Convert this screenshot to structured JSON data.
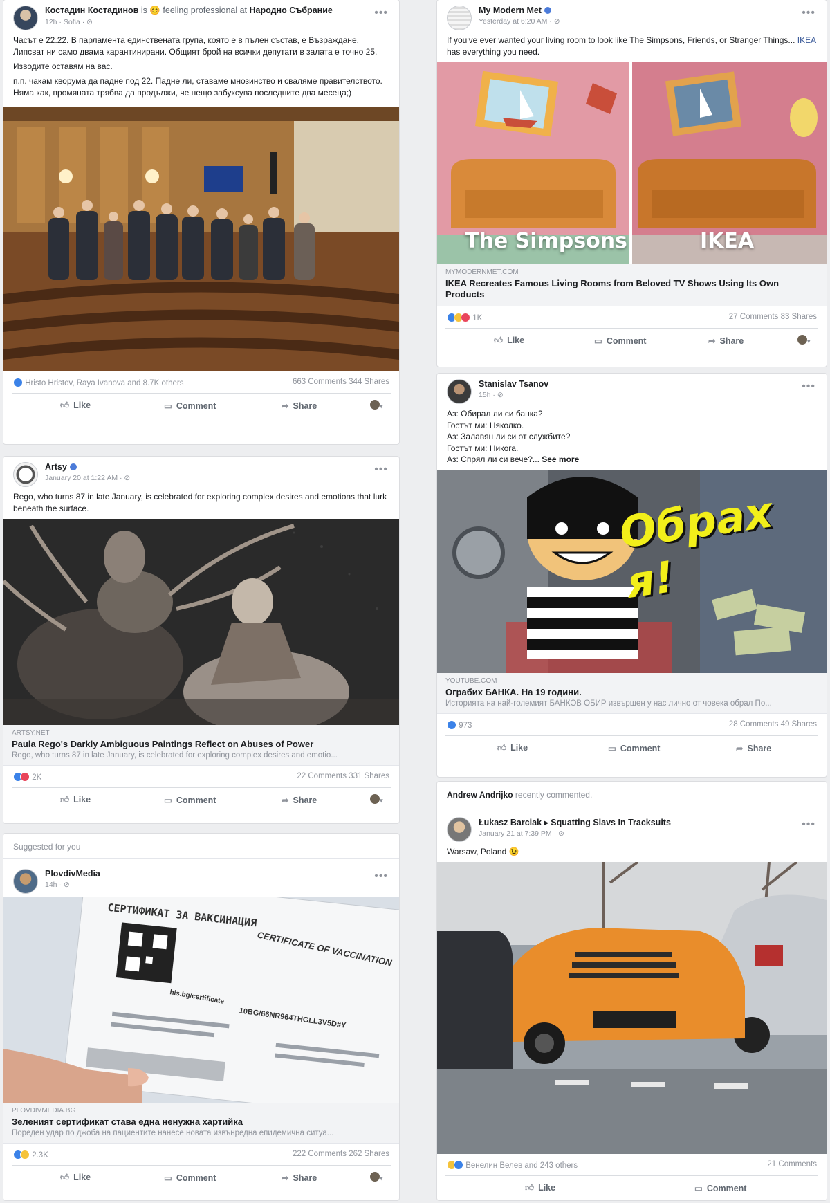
{
  "left_col": {
    "post1": {
      "author": "Костадин Костадинов",
      "feeling": "is 😊 feeling professional at",
      "place": "Народно Събрание",
      "meta": "12h · Sofia · ⊘",
      "paragraphs": [
        "Часът е 22.22. В парламента единствената група, която е в пълен състав, е Възраждане. Липсват ни само двама карантинирани. Общият брой на всички депутати в залата е точно 25.",
        "Изводите оставям на вас.",
        "п.п. чакам кворума да падне под 22. Падне ли, ставаме мнозинство и сваляме правителството. Няма как, промяната трябва да продължи, че нещо забуксува последните два месеца;)"
      ],
      "reactions": "Hristo Hristov, Raya Ivanova and 8.7K others",
      "counts": "663 Comments  344 Shares"
    },
    "post2": {
      "author": "Artsy",
      "meta": "January 20 at 1:22 AM · ⊘",
      "text": "Rego, who turns 87 in late January, is celebrated for exploring complex desires and emotions that lurk beneath the surface.",
      "domain": "ARTSY.NET",
      "title": "Paula Rego's Darkly Ambiguous Paintings Reflect on Abuses of Power",
      "desc": "Rego, who turns 87 in late January, is celebrated for exploring complex desires and emotio...",
      "reactions": "2K",
      "counts": "22 Comments  331 Shares"
    },
    "post3": {
      "suggested": "Suggested for you",
      "author": "PlovdivMedia",
      "meta": "14h · ⊘",
      "cert_bg": "СЕРТИФИКАТ ЗА ВАКСИНАЦИЯ",
      "cert_en": "CERTIFICATE OF VACCINATION",
      "cert_id": "10BG/66NR964THGLL3V5D#Y",
      "cert_url": "his.bg/certificate",
      "domain": "PLOVDIVMEDIA.BG",
      "title": "Зеленият сертификат става една ненужна хартийка",
      "desc": "Пореден удар по джоба на пациентите нанесе новата извънредна епидемична ситуа...",
      "reactions": "2.3K",
      "counts": "222 Comments  262 Shares"
    }
  },
  "right_col": {
    "post1": {
      "author": "My Modern Met",
      "meta": "Yesterday at 6:20 AM · ⊘",
      "text_pre": "If you've ever wanted your living room to look like The Simpsons, Friends, or Stranger Things...",
      "text_link": "IKEA",
      "text_post": " has everything you need.",
      "caption_left": "The Simpsons",
      "caption_right": "IKEA",
      "domain": "MYMODERNMET.COM",
      "title": "IKEA Recreates Famous Living Rooms from Beloved TV Shows Using Its Own Products",
      "reactions": "1K",
      "counts": "27 Comments  83 Shares"
    },
    "post2": {
      "author": "Stanislav Tsanov",
      "meta": "15h · ⊘",
      "lines": [
        "Аз: Обирал ли си банка?",
        "Гостът ми: Няколко.",
        "Аз: Залавян ли си от службите?",
        "Гостът ми: Никога.",
        "Аз: Спрял ли си вече?..."
      ],
      "see_more": "See more",
      "thumb_text": "Обрах я!",
      "domain": "YOUTUBE.COM",
      "title": "Ограбих БАНКА. На 19 години.",
      "desc": "Историята на най-големият БАНКОВ ОБИР извършен у нас лично от човека обрал По...",
      "reactions": "973",
      "counts": "28 Comments  49 Shares"
    },
    "post3": {
      "commenter": "Andrew Andrijko",
      "commented": "recently commented.",
      "author": "Łukasz Barciak ▸ Squatting Slavs In Tracksuits",
      "meta": "January 21 at 7:39 PM · ⊘",
      "text": "Warsaw, Poland 😉",
      "reactions": "Венелин Велев and 243 others",
      "counts": "21 Comments"
    }
  },
  "actions": {
    "like": "Like",
    "comment": "Comment",
    "share": "Share"
  },
  "icons": {
    "like": "thumbs-up-icon",
    "comment": "comment-icon",
    "share": "share-icon",
    "more": "more-options-icon"
  },
  "colors": {
    "like_blue": "#3b82e8",
    "love_red": "#e9455b",
    "link_blue": "#385898",
    "bg": "#edeef0"
  }
}
